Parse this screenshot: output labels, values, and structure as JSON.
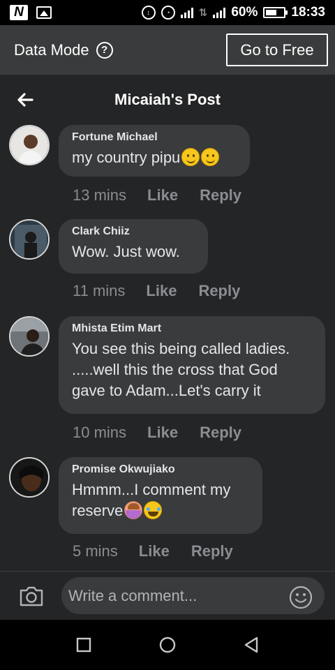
{
  "status_bar": {
    "battery": "60%",
    "time": "18:33",
    "icons": [
      "n-app-icon",
      "gallery-icon",
      "data-saver-icon",
      "alarm-icon",
      "signal-icon",
      "data-arrows-icon",
      "signal-icon-2",
      "battery-icon"
    ]
  },
  "data_bar": {
    "label": "Data Mode",
    "help_icon": "?",
    "go_free_label": "Go to Free"
  },
  "header": {
    "title": "Micaiah's Post",
    "back_icon": "arrow-left-icon"
  },
  "comments": [
    {
      "author": "Fortune Michael",
      "text": "my country pipu",
      "emojis": [
        "smile",
        "smile"
      ],
      "time": "13 mins",
      "like": "Like",
      "reply": "Reply"
    },
    {
      "author": "Clark Chiiz",
      "text": "Wow. Just wow.",
      "emojis": [],
      "time": "11 mins",
      "like": "Like",
      "reply": "Reply"
    },
    {
      "author": "Mhista Etim Mart",
      "text_lines": [
        "You see this being called ladies.",
        ".....well this the cross that God",
        "gave to Adam...Let's carry it"
      ],
      "emojis": [],
      "time": "10 mins",
      "like": "Like",
      "reply": "Reply"
    },
    {
      "author": "Promise Okwujiako",
      "text_lines": [
        "Hmmm...I comment my",
        "reserve"
      ],
      "emojis": [
        "woman-gesturing",
        "laughing-tears"
      ],
      "time": "5 mins",
      "like": "Like",
      "reply": "Reply"
    }
  ],
  "composer": {
    "placeholder": "Write a comment...",
    "camera_icon": "camera-icon",
    "emoji_icon": "emoji-icon"
  },
  "nav": {
    "buttons": [
      "recents-square-icon",
      "home-circle-icon",
      "back-triangle-icon"
    ]
  },
  "colors": {
    "app_bg": "#242526",
    "bubble_bg": "#3a3b3c",
    "text_primary": "#e4e6eb",
    "text_secondary": "#8a8d91"
  }
}
